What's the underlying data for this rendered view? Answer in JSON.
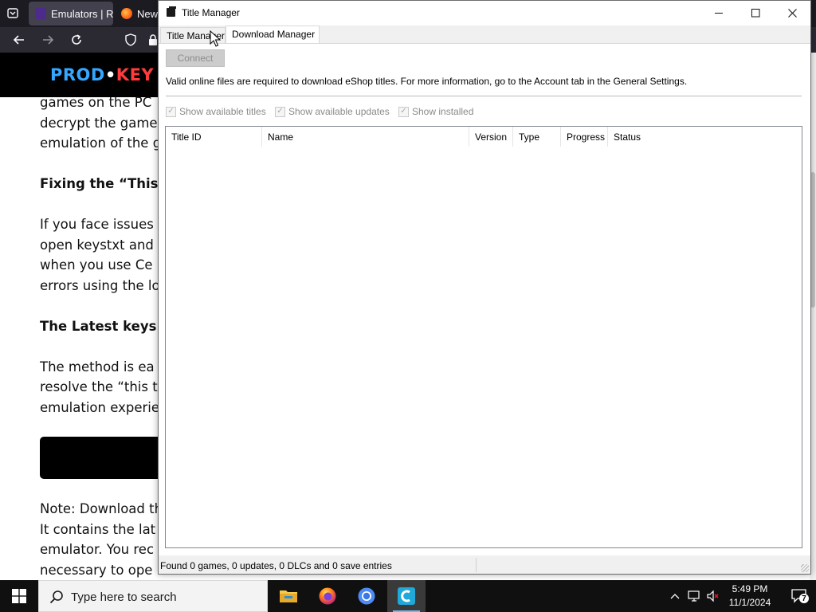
{
  "browser": {
    "tabs": [
      {
        "label": "Emulators | Ro",
        "active": true
      },
      {
        "label": "New",
        "active": false
      }
    ],
    "site_logo": {
      "part1": "PROD",
      "dot": "•",
      "part2": "KEY"
    },
    "article_lines": [
      {
        "text": "games on the PC",
        "kind": "body"
      },
      {
        "text": "decrypt the game",
        "kind": "body"
      },
      {
        "text": "emulation of the g",
        "kind": "body"
      },
      {
        "text": "",
        "kind": "gap"
      },
      {
        "text": "Fixing the “This ti",
        "kind": "heading"
      },
      {
        "text": "",
        "kind": "gap"
      },
      {
        "text": "If you face issues",
        "kind": "body"
      },
      {
        "text": "open keystxt and",
        "kind": "body"
      },
      {
        "text": "when you use Ce",
        "kind": "body"
      },
      {
        "text": "errors using the lo",
        "kind": "body"
      },
      {
        "text": "",
        "kind": "gap"
      },
      {
        "text": "The Latest keys.tx",
        "kind": "heading"
      },
      {
        "text": "",
        "kind": "gap"
      },
      {
        "text": "The method is ea",
        "kind": "body"
      },
      {
        "text": "resolve the “this ti",
        "kind": "body"
      },
      {
        "text": "emulation experie",
        "kind": "body"
      }
    ],
    "article_lines_bottom": [
      {
        "text": "Note: Download th",
        "kind": "body"
      },
      {
        "text": "It contains the lat",
        "kind": "body"
      },
      {
        "text": "emulator. You rec",
        "kind": "body"
      },
      {
        "text": "necessary to ope",
        "kind": "body"
      }
    ]
  },
  "window": {
    "title": "Title Manager",
    "controls": {
      "minimize": "—",
      "maximize": "☐",
      "close": "✕"
    },
    "tabs": [
      {
        "label": "Title Manager",
        "selected": false
      },
      {
        "label": "Download Manager",
        "selected": true
      }
    ],
    "connect_label": "Connect",
    "info_text": "Valid online files are required to download eShop titles. For more information, go to the Account tab in the General Settings.",
    "checkboxes": [
      {
        "label": "Show available titles",
        "checked": true,
        "enabled": false
      },
      {
        "label": "Show available updates",
        "checked": true,
        "enabled": false
      },
      {
        "label": "Show installed",
        "checked": true,
        "enabled": false
      }
    ],
    "table": {
      "columns": [
        "Title ID",
        "Name",
        "Version",
        "Type",
        "Progress",
        "Status"
      ],
      "rows": []
    },
    "status_text": "Found 0 games, 0 updates, 0 DLCs and 0 save entries"
  },
  "taskbar": {
    "search_placeholder": "Type here to search",
    "apps": [
      "file-explorer",
      "firefox",
      "chromium",
      "cemu"
    ],
    "active_app": "cemu",
    "time": "5:49 PM",
    "date": "11/1/2024",
    "notification_count": "7"
  }
}
